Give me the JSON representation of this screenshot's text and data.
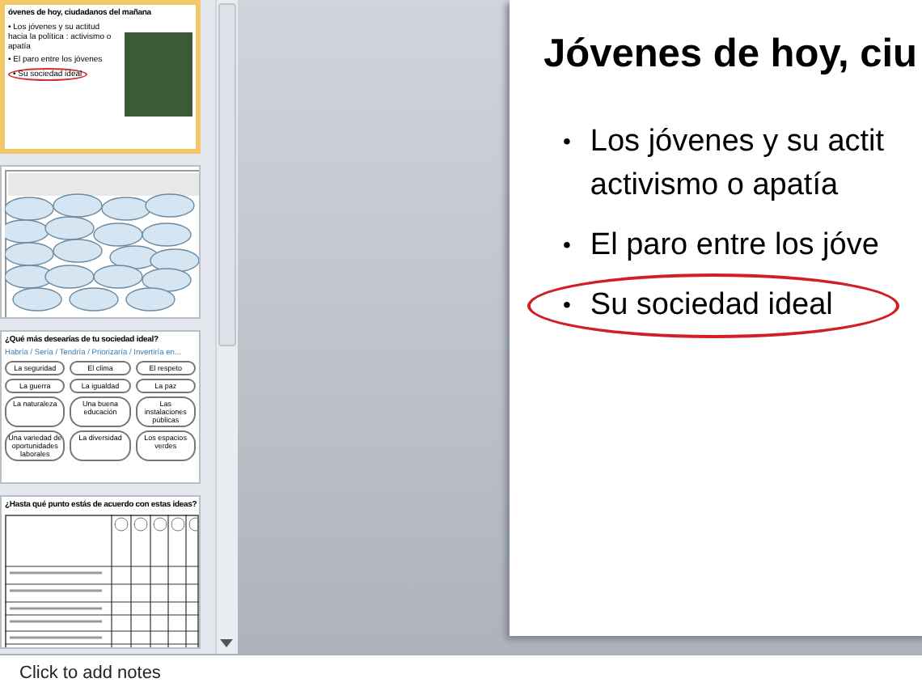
{
  "slides_panel": {
    "thumbnails": [
      {
        "kind": "title_bullets",
        "selected": true,
        "title": "óvenes de hoy, ciudadanos del mañana",
        "bullet": "•",
        "bullets": [
          {
            "text": "Los jóvenes y su actitud hacia la política : activismo o apatía",
            "circled": false
          },
          {
            "text": "El paro entre los jóvenes",
            "circled": false
          },
          {
            "text": "Su sociedad ideal",
            "circled": true
          }
        ]
      },
      {
        "kind": "clouds",
        "selected": false
      },
      {
        "kind": "cloud_words",
        "selected": false,
        "title": "¿Qué más desearías de tu sociedad ideal?",
        "subtitle": "Habría / Sería / Tendría / Priorizaría / Invertiría en...",
        "clouds": [
          "La seguridad",
          "El clima",
          "El respeto",
          "La guerra",
          "La igualdad",
          "La paz",
          "La naturaleza",
          "Una buena educación",
          "Las instalaciones públicas",
          "Una variedad de oportunidades laborales",
          "La diversidad",
          "Los espacios verdes"
        ]
      },
      {
        "kind": "table",
        "selected": false,
        "title": "¿Hasta qué punto estás de acuerdo con estas ideas?"
      }
    ]
  },
  "slide": {
    "title": "Jóvenes de hoy, ciu",
    "bullet": "•",
    "bullets": [
      {
        "lines": [
          "Los jóvenes y su actit",
          "activismo o apatía"
        ],
        "circled": false
      },
      {
        "lines": [
          "El paro entre los jóve"
        ],
        "circled": false
      },
      {
        "lines": [
          "Su sociedad ideal"
        ],
        "circled": true
      }
    ]
  },
  "notes": {
    "placeholder": "Click to add notes"
  }
}
